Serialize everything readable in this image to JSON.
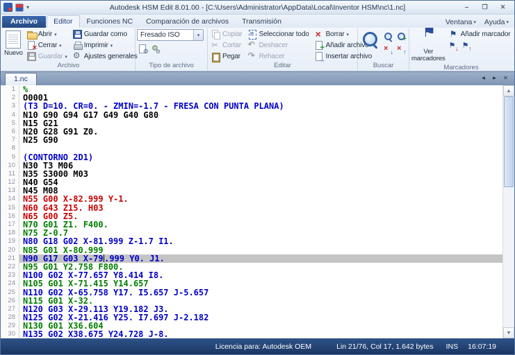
{
  "window": {
    "title": "Autodesk HSM Edit 8.01.00 - [C:\\Users\\Administrator\\AppData\\Local\\Inventor HSM\\nc\\1.nc]"
  },
  "tabs": [
    "Archivo",
    "Editor",
    "Funciones NC",
    "Comparación de archivos",
    "Transmisión"
  ],
  "right_menus": {
    "ventana": "Ventana",
    "ayuda": "Ayuda"
  },
  "ribbon": {
    "archivo": {
      "label": "Archivo",
      "nuevo": "Nuevo",
      "abrir": "Abrir",
      "cerrar": "Cerrar",
      "guardar": "Guardar",
      "guardar_como": "Guardar como",
      "imprimir": "Imprimir",
      "ajustes_generales": "Ajustes generales"
    },
    "tipo": {
      "label": "Tipo de archivo",
      "selected": "Fresado ISO"
    },
    "editar": {
      "label": "Editar",
      "copiar": "Copiar",
      "cortar": "Cortar",
      "pegar": "Pegar",
      "seleccionar_todo": "Seleccionar todo",
      "deshacer": "Deshacer",
      "rehacer": "Rehacer",
      "borrar": "Borrar",
      "anadir_archivo": "Añadir archivo",
      "insertar_archivo": "Insertar archivo"
    },
    "buscar": {
      "label": "Buscar"
    },
    "marcadores": {
      "label": "Marcadores",
      "ver_marcadores": "Ver marcadores",
      "anadir_marcador": "Añadir marcador"
    }
  },
  "doc_tabs": {
    "active": "1.nc"
  },
  "editor": {
    "current_line": 21,
    "cursor_col": 17,
    "lines": [
      {
        "num": 1,
        "text": "%",
        "color": "green"
      },
      {
        "num": 2,
        "text": "O0001",
        "color": "black"
      },
      {
        "num": 3,
        "text": "(T3 D=10. CR=0. - ZMIN=-1.7 - FRESA CON PUNTA PLANA)",
        "color": "blue"
      },
      {
        "num": 4,
        "text": "N10 G90 G94 G17 G49 G40 G80",
        "color": "black"
      },
      {
        "num": 5,
        "text": "N15 G21",
        "color": "black"
      },
      {
        "num": 6,
        "text": "N20 G28 G91 Z0.",
        "color": "black"
      },
      {
        "num": 7,
        "text": "N25 G90",
        "color": "black"
      },
      {
        "num": 8,
        "text": "",
        "color": "black"
      },
      {
        "num": 9,
        "text": "(CONTORNO 2D1)",
        "color": "blue"
      },
      {
        "num": 10,
        "text": "N30 T3 M06",
        "color": "black"
      },
      {
        "num": 11,
        "text": "N35 S3000 M03",
        "color": "black"
      },
      {
        "num": 12,
        "text": "N40 G54",
        "color": "black"
      },
      {
        "num": 13,
        "text": "N45 M08",
        "color": "black"
      },
      {
        "num": 14,
        "text": "N55 G00 X-82.999 Y-1.",
        "color": "red"
      },
      {
        "num": 15,
        "text": "N60 G43 Z15. H03",
        "color": "red"
      },
      {
        "num": 16,
        "text": "N65 G00 Z5.",
        "color": "red"
      },
      {
        "num": 17,
        "text": "N70 G01 Z1. F400.",
        "color": "green"
      },
      {
        "num": 18,
        "text": "N75 Z-0.7",
        "color": "green"
      },
      {
        "num": 19,
        "text": "N80 G18 G02 X-81.999 Z-1.7 I1.",
        "color": "blue"
      },
      {
        "num": 20,
        "text": "N85 G01 X-80.999",
        "color": "green"
      },
      {
        "num": 21,
        "text": "N90 G17 G03 X-79.999 Y0. J1.",
        "color": "blue"
      },
      {
        "num": 22,
        "text": "N95 G01 Y2.758 F800.",
        "color": "green"
      },
      {
        "num": 23,
        "text": "N100 G02 X-77.657 Y8.414 I8.",
        "color": "blue"
      },
      {
        "num": 24,
        "text": "N105 G01 X-71.415 Y14.657",
        "color": "green"
      },
      {
        "num": 25,
        "text": "N110 G02 X-65.758 Y17. I5.657 J-5.657",
        "color": "blue"
      },
      {
        "num": 26,
        "text": "N115 G01 X-32.",
        "color": "green"
      },
      {
        "num": 27,
        "text": "N120 G03 X-29.113 Y19.182 J3.",
        "color": "blue"
      },
      {
        "num": 28,
        "text": "N125 G02 X-21.416 Y25. I7.697 J-2.182",
        "color": "blue"
      },
      {
        "num": 29,
        "text": "N130 G01 X36.604",
        "color": "green"
      },
      {
        "num": 30,
        "text": "N135 G02 X38.675 Y24.728 J-8.",
        "color": "blue"
      }
    ]
  },
  "status": {
    "license": "Licencia para: Autodesk OEM",
    "position": "Lin 21/76, Col 17, 1.642 bytes",
    "mode": "INS",
    "time": "16:07:19"
  },
  "colors": {
    "accent": "#27447E",
    "code_green": "#007D00",
    "code_blue": "#0000C8",
    "code_red": "#C80000",
    "current_line_bg": "#C4C4C4"
  }
}
